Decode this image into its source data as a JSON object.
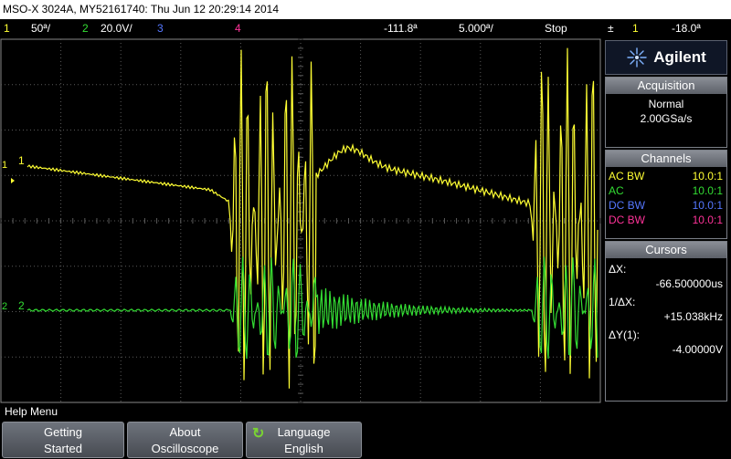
{
  "title_bar": {
    "text": "MSO-X 3024A, MY52161740: Thu Jun 12 20:29:14 2014"
  },
  "status_bar": {
    "ch1_num": "1",
    "ch1_scale": "50ª/",
    "ch2_num": "2",
    "ch2_scale": "20.0V/",
    "ch3_num": "3",
    "ch4_num": "4",
    "delay": "-111.8ª",
    "timebase": "5.000ª/",
    "run_state": "Stop",
    "trig_symbol": "±",
    "trig_source": "1",
    "trig_level": "-18.0ª"
  },
  "colors": {
    "ch1": "#ffff33",
    "ch2": "#33dd33",
    "ch3": "#5577ff",
    "ch4": "#ff3399",
    "grid": "#5a5a5a",
    "panel_border": "#7b7f87"
  },
  "display": {
    "ch1_marker": "1",
    "ch2_marker": "2"
  },
  "side_panel": {
    "logo_icon": "agilent-spark-icon",
    "logo_text": "Agilent",
    "acquisition": {
      "header": "Acquisition",
      "mode": "Normal",
      "rate": "2.00GSa/s"
    },
    "channels": {
      "header": "Channels",
      "rows": [
        {
          "coupling": "AC BW",
          "probe": "10.0:1"
        },
        {
          "coupling": "AC",
          "probe": "10.0:1"
        },
        {
          "coupling": "DC BW",
          "probe": "10.0:1"
        },
        {
          "coupling": "DC BW",
          "probe": "10.0:1"
        }
      ]
    },
    "cursors": {
      "header": "Cursors",
      "dx_label": "ΔX:",
      "dx_value": "-66.500000us",
      "inv_dx_label": "1/ΔX:",
      "inv_dx_value": "+15.038kHz",
      "dy_label": "ΔY(1):",
      "dy_value": "-4.00000V"
    }
  },
  "help_menu": {
    "label": "Help Menu"
  },
  "softkeys": [
    {
      "line1": "Getting",
      "line2": "Started"
    },
    {
      "line1": "About",
      "line2": "Oscilloscope"
    },
    {
      "line1": "Language",
      "line2": "English",
      "icon": "rotate-knob-icon"
    }
  ]
}
